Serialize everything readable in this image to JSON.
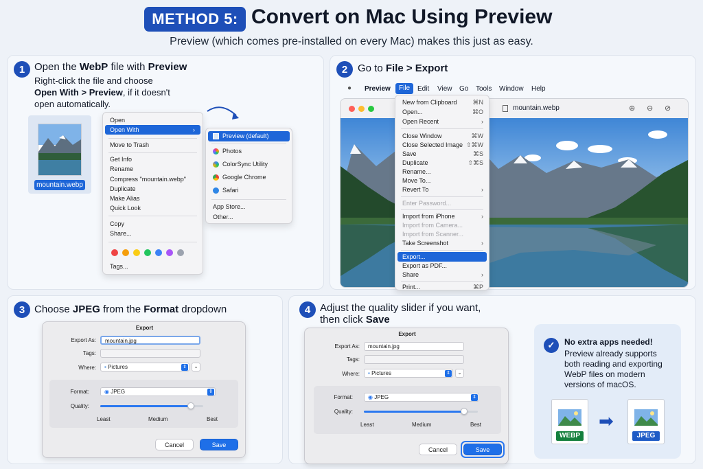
{
  "header": {
    "badge": "METHOD 5:",
    "title": "Convert on Mac Using Preview",
    "subtitle": "Preview (which comes pre-installed on every Mac) makes this just as easy."
  },
  "step1": {
    "num": "1",
    "t_a": "Open the ",
    "t_b": "WebP",
    "t_c": " file with ",
    "t_d": "Preview",
    "d1": "Right-click the file and choose",
    "d2a": "Open With > Preview",
    "d2b": ", if it doesn't",
    "d3": "open automatically.",
    "filename": "mountain.webp",
    "context_menu": [
      "Open",
      "Open With",
      "Move to Trash",
      "Get Info",
      "Rename",
      "Compress \"mountain.webp\"",
      "Duplicate",
      "Make Alias",
      "Quick Look",
      "Copy",
      "Share...",
      "Tags..."
    ],
    "submenu": [
      "Preview (default)",
      "Photos",
      "ColorSync Utility",
      "Google Chrome",
      "Safari",
      "App Store...",
      "Other..."
    ],
    "tag_colors": [
      "#ef4444",
      "#f59e0b",
      "#facc15",
      "#22c55e",
      "#3b82f6",
      "#a855f7",
      "#9ca3af"
    ]
  },
  "step2": {
    "num": "2",
    "t_a": "Go to ",
    "t_b": "File > Export",
    "menubar": [
      "Preview",
      "File",
      "Edit",
      "View",
      "Go",
      "Tools",
      "Window",
      "Help"
    ],
    "window_title": "mountain.webp",
    "file_menu": [
      {
        "label": "New from Clipboard",
        "sc": "⌘N"
      },
      {
        "label": "Open...",
        "sc": "⌘O"
      },
      {
        "label": "Open Recent",
        "sc": "›"
      },
      {
        "label": "Close Window",
        "sc": "⌘W"
      },
      {
        "label": "Close Selected Image",
        "sc": "⇧⌘W"
      },
      {
        "label": "Save",
        "sc": "⌘S"
      },
      {
        "label": "Duplicate",
        "sc": "⇧⌘S"
      },
      {
        "label": "Rename...",
        "sc": ""
      },
      {
        "label": "Move To...",
        "sc": ""
      },
      {
        "label": "Revert To",
        "sc": "›"
      },
      {
        "label": "Enter Password...",
        "sc": ""
      },
      {
        "label": "Import from iPhone",
        "sc": "›"
      },
      {
        "label": "Import from Camera...",
        "sc": ""
      },
      {
        "label": "Import from Scanner...",
        "sc": ""
      },
      {
        "label": "Take Screenshot",
        "sc": "›"
      },
      {
        "label": "Export...",
        "sc": ""
      },
      {
        "label": "Export as PDF...",
        "sc": ""
      },
      {
        "label": "Share",
        "sc": "›"
      },
      {
        "label": "Print...",
        "sc": "⌘P"
      }
    ]
  },
  "step3": {
    "num": "3",
    "t_a": "Choose ",
    "t_b": "JPEG",
    "t_c": " from the ",
    "t_d": "Format",
    "t_e": " dropdown",
    "dialog": {
      "title": "Export",
      "export_as_label": "Export As:",
      "export_as": "mountain.jpg",
      "tags_label": "Tags:",
      "where_label": "Where:",
      "where": "Pictures",
      "format_label": "Format:",
      "format": "JPEG",
      "quality_label": "Quality:",
      "least": "Least",
      "medium": "Medium",
      "best": "Best",
      "cancel": "Cancel",
      "save": "Save",
      "quality": 0.88
    }
  },
  "step4": {
    "num": "4",
    "t1": "Adjust the quality slider if you want,",
    "t2a": "then click ",
    "t2b": "Save",
    "dialog": {
      "title": "Export",
      "export_as_label": "Export As:",
      "export_as": "mountain.jpg",
      "tags_label": "Tags:",
      "where_label": "Where:",
      "where": "Pictures",
      "format_label": "Format:",
      "format": "JPEG",
      "quality_label": "Quality:",
      "least": "Least",
      "medium": "Medium",
      "best": "Best",
      "cancel": "Cancel",
      "save": "Save",
      "quality": 0.88
    }
  },
  "info": {
    "title": "No extra apps needed!",
    "body1": "Preview already supports",
    "body2": "both reading and exporting",
    "body3": "WebP files on modern",
    "body4": "versions of macOS.",
    "from": "WEBP",
    "to": "JPEG",
    "from_color": "#15803d",
    "to_color": "#1e5bc6"
  },
  "colors": {
    "accent": "#1e4fb8",
    "selection": "#1e66d8"
  }
}
